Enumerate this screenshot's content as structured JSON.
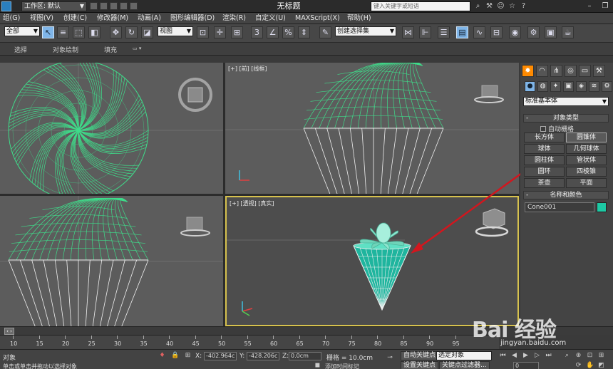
{
  "titlebar": {
    "workspace_label": "工作区: 默认",
    "window_title": "无标题",
    "search_placeholder": "键入关键字或短语"
  },
  "menu": {
    "items": [
      "组(G)",
      "视图(V)",
      "创建(C)",
      "修改器(M)",
      "动画(A)",
      "图形编辑器(D)",
      "渲染(R)",
      "自定义(U)",
      "MAXScript(X)",
      "帮助(H)"
    ]
  },
  "toolbar": {
    "selection_filter": "全部",
    "reference_coord": "视图",
    "named_selection_set": "创建选择集"
  },
  "ribbon": {
    "tabs": [
      "选择",
      "对象绘制",
      "填充"
    ]
  },
  "viewports": {
    "front_label": "[+] [前] [线框]",
    "perspective_label": "[+] [透视] [真实]"
  },
  "command_panel": {
    "category": "标准基本体",
    "object_type_title": "对象类型",
    "autogrid_label": "自动栅格",
    "object_buttons": [
      "长方体",
      "圆锥体",
      "球体",
      "几何球体",
      "圆柱体",
      "管状体",
      "圆环",
      "四棱锥",
      "茶壶",
      "平面"
    ],
    "name_color_title": "名称和颜色",
    "object_name": "Cone001",
    "object_color": "#1dc9a4"
  },
  "timeline": {
    "ticks": [
      "10",
      "15",
      "20",
      "25",
      "30",
      "35",
      "40",
      "45",
      "50",
      "55",
      "60",
      "65",
      "70",
      "75",
      "80",
      "85",
      "90",
      "95"
    ]
  },
  "status": {
    "selection_label": "对象",
    "prompt_text": "单击或单击并拖动以选择对象",
    "x_label": "X:",
    "x_value": "-402.964c",
    "y_label": "Y:",
    "y_value": "-428.206c",
    "z_label": "Z:",
    "z_value": "0.0cm",
    "grid_label": "栅格 = 10.0cm",
    "auto_key": "自动关键点",
    "set_key": "设置关键点",
    "key_mode_select": "选定对象",
    "key_filters": "关键点过滤器...",
    "add_time_tag": "添加时间标记",
    "frame_value": "0"
  },
  "watermark": {
    "main": "Bai 经验",
    "sub": "jingyan.baidu.com"
  },
  "colors": {
    "wire_green": "#3fdc8a",
    "wire_white": "#f0f0f0",
    "active_border": "#d7c24e",
    "highlight_red": "#d2161e",
    "cone_fill": "#1fb59e"
  }
}
